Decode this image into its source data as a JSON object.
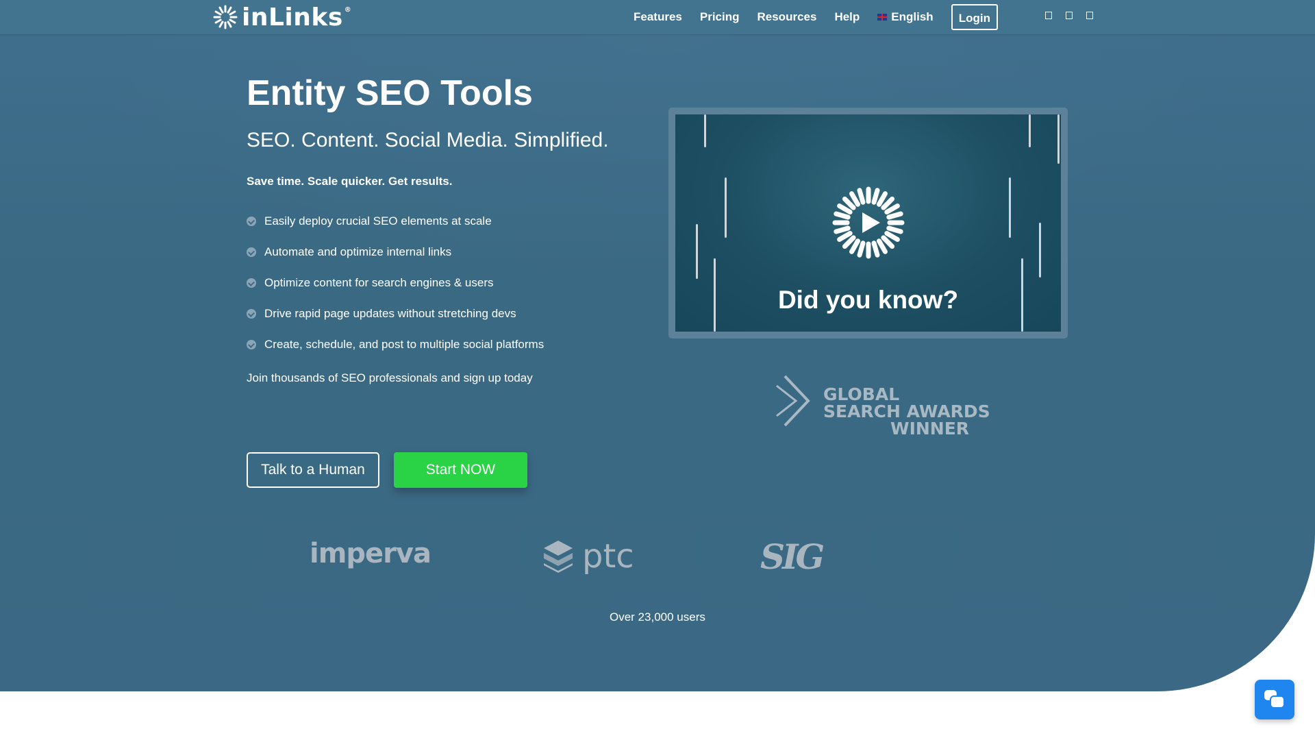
{
  "brand": {
    "name": "inLinks",
    "registered": "®"
  },
  "nav": {
    "items": [
      "Features",
      "Pricing",
      "Resources",
      "Help"
    ],
    "language": "English",
    "login": "Login",
    "social_icons": [
      "social-icon-1",
      "social-icon-2",
      "social-icon-3"
    ]
  },
  "hero": {
    "title": "Entity SEO Tools",
    "subtitle": "SEO. Content. Social Media. Simplified.",
    "tagline": "Save time. Scale quicker. Get results.",
    "features": [
      "Easily deploy crucial SEO elements at scale",
      "Automate and optimize internal links",
      "Optimize content for search engines & users",
      "Drive rapid page updates without stretching devs",
      "Create, schedule, and post to multiple social platforms"
    ],
    "join_text": "Join thousands of SEO professionals and sign up today",
    "cta_secondary": "Talk to a Human",
    "cta_primary": "Start NOW"
  },
  "video": {
    "title": "Did you know?"
  },
  "award": {
    "lines": [
      "GLOBAL",
      "SEARCH AWARDS",
      "WINNER"
    ]
  },
  "clients": {
    "imperva": "imperva",
    "ptc": "ptc",
    "sig": "SIG"
  },
  "users_count": "Over 23,000 users",
  "colors": {
    "hero_bg": "#3b6985",
    "topbar_bg": "#42748f",
    "cta_primary": "#2ad346",
    "chat_button": "#1f86f0"
  }
}
